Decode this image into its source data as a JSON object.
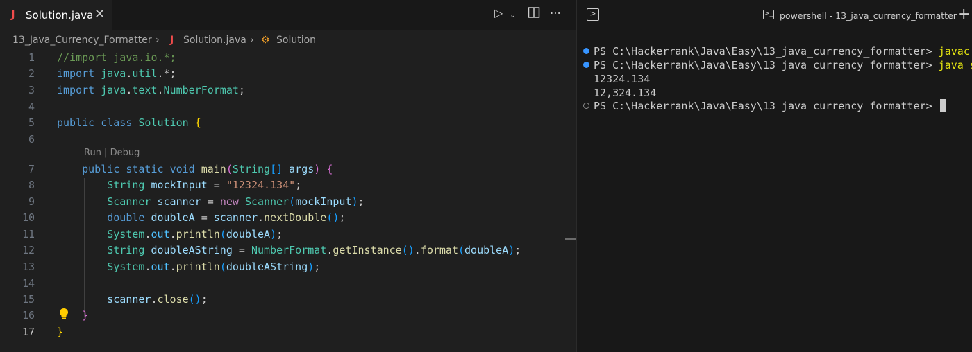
{
  "editor": {
    "tab": {
      "icon": "J",
      "filename": "Solution.java"
    },
    "breadcrumb": {
      "folder": "13_Java_Currency_Formatter",
      "file": "Solution.java",
      "symbol": "Solution"
    },
    "codelens": "Run | Debug",
    "current_line": "17",
    "lines": [
      {
        "num": "1",
        "tokens": [
          {
            "t": "//import java.io.*;",
            "c": "#6a9955"
          }
        ]
      },
      {
        "num": "2",
        "tokens": [
          {
            "t": "import ",
            "c": "#569cd6"
          },
          {
            "t": "java",
            "c": "#4ec9b0"
          },
          {
            "t": ".",
            "c": "#cccccc"
          },
          {
            "t": "util",
            "c": "#4ec9b0"
          },
          {
            "t": ".*;",
            "c": "#cccccc"
          }
        ]
      },
      {
        "num": "3",
        "tokens": [
          {
            "t": "import ",
            "c": "#569cd6"
          },
          {
            "t": "java",
            "c": "#4ec9b0"
          },
          {
            "t": ".",
            "c": "#cccccc"
          },
          {
            "t": "text",
            "c": "#4ec9b0"
          },
          {
            "t": ".",
            "c": "#cccccc"
          },
          {
            "t": "NumberFormat",
            "c": "#4ec9b0"
          },
          {
            "t": ";",
            "c": "#cccccc"
          }
        ]
      },
      {
        "num": "4",
        "tokens": []
      },
      {
        "num": "5",
        "tokens": [
          {
            "t": "public ",
            "c": "#569cd6"
          },
          {
            "t": "class ",
            "c": "#569cd6"
          },
          {
            "t": "Solution ",
            "c": "#4ec9b0"
          },
          {
            "t": "{",
            "c": "#ffd700"
          }
        ]
      },
      {
        "num": "6",
        "tokens": []
      },
      {
        "num": "7",
        "tokens": [
          {
            "t": "    public ",
            "c": "#569cd6"
          },
          {
            "t": "static ",
            "c": "#569cd6"
          },
          {
            "t": "void ",
            "c": "#569cd6"
          },
          {
            "t": "main",
            "c": "#dcdcaa"
          },
          {
            "t": "(",
            "c": "#da70d6"
          },
          {
            "t": "String",
            "c": "#4ec9b0"
          },
          {
            "t": "[] ",
            "c": "#179fff"
          },
          {
            "t": "args",
            "c": "#9cdcfe"
          },
          {
            "t": ") ",
            "c": "#da70d6"
          },
          {
            "t": "{",
            "c": "#da70d6"
          }
        ]
      },
      {
        "num": "8",
        "tokens": [
          {
            "t": "        String ",
            "c": "#4ec9b0"
          },
          {
            "t": "mockInput",
            "c": "#9cdcfe"
          },
          {
            "t": " = ",
            "c": "#cccccc"
          },
          {
            "t": "\"12324.134\"",
            "c": "#ce9178"
          },
          {
            "t": ";",
            "c": "#cccccc"
          }
        ]
      },
      {
        "num": "9",
        "tokens": [
          {
            "t": "        Scanner ",
            "c": "#4ec9b0"
          },
          {
            "t": "scanner",
            "c": "#9cdcfe"
          },
          {
            "t": " = ",
            "c": "#cccccc"
          },
          {
            "t": "new ",
            "c": "#c586c0"
          },
          {
            "t": "Scanner",
            "c": "#4ec9b0"
          },
          {
            "t": "(",
            "c": "#179fff"
          },
          {
            "t": "mockInput",
            "c": "#9cdcfe"
          },
          {
            "t": ")",
            "c": "#179fff"
          },
          {
            "t": ";",
            "c": "#cccccc"
          }
        ]
      },
      {
        "num": "10",
        "tokens": [
          {
            "t": "        double ",
            "c": "#569cd6"
          },
          {
            "t": "doubleA",
            "c": "#9cdcfe"
          },
          {
            "t": " = ",
            "c": "#cccccc"
          },
          {
            "t": "scanner",
            "c": "#9cdcfe"
          },
          {
            "t": ".",
            "c": "#cccccc"
          },
          {
            "t": "nextDouble",
            "c": "#dcdcaa"
          },
          {
            "t": "()",
            "c": "#179fff"
          },
          {
            "t": ";",
            "c": "#cccccc"
          }
        ]
      },
      {
        "num": "11",
        "tokens": [
          {
            "t": "        System",
            "c": "#4ec9b0"
          },
          {
            "t": ".",
            "c": "#cccccc"
          },
          {
            "t": "out",
            "c": "#4fc1ff"
          },
          {
            "t": ".",
            "c": "#cccccc"
          },
          {
            "t": "println",
            "c": "#dcdcaa"
          },
          {
            "t": "(",
            "c": "#179fff"
          },
          {
            "t": "doubleA",
            "c": "#9cdcfe"
          },
          {
            "t": ")",
            "c": "#179fff"
          },
          {
            "t": ";",
            "c": "#cccccc"
          }
        ]
      },
      {
        "num": "12",
        "tokens": [
          {
            "t": "        String ",
            "c": "#4ec9b0"
          },
          {
            "t": "doubleAString",
            "c": "#9cdcfe"
          },
          {
            "t": " = ",
            "c": "#cccccc"
          },
          {
            "t": "NumberFormat",
            "c": "#4ec9b0"
          },
          {
            "t": ".",
            "c": "#cccccc"
          },
          {
            "t": "getInstance",
            "c": "#dcdcaa"
          },
          {
            "t": "()",
            "c": "#179fff"
          },
          {
            "t": ".",
            "c": "#cccccc"
          },
          {
            "t": "format",
            "c": "#dcdcaa"
          },
          {
            "t": "(",
            "c": "#179fff"
          },
          {
            "t": "doubleA",
            "c": "#9cdcfe"
          },
          {
            "t": ")",
            "c": "#179fff"
          },
          {
            "t": ";",
            "c": "#cccccc"
          }
        ]
      },
      {
        "num": "13",
        "tokens": [
          {
            "t": "        System",
            "c": "#4ec9b0"
          },
          {
            "t": ".",
            "c": "#cccccc"
          },
          {
            "t": "out",
            "c": "#4fc1ff"
          },
          {
            "t": ".",
            "c": "#cccccc"
          },
          {
            "t": "println",
            "c": "#dcdcaa"
          },
          {
            "t": "(",
            "c": "#179fff"
          },
          {
            "t": "doubleAString",
            "c": "#9cdcfe"
          },
          {
            "t": ")",
            "c": "#179fff"
          },
          {
            "t": ";",
            "c": "#cccccc"
          }
        ]
      },
      {
        "num": "14",
        "tokens": []
      },
      {
        "num": "15",
        "tokens": [
          {
            "t": "        scanner",
            "c": "#9cdcfe"
          },
          {
            "t": ".",
            "c": "#cccccc"
          },
          {
            "t": "close",
            "c": "#dcdcaa"
          },
          {
            "t": "()",
            "c": "#179fff"
          },
          {
            "t": ";",
            "c": "#cccccc"
          }
        ]
      },
      {
        "num": "16",
        "tokens": [
          {
            "t": "    }",
            "c": "#da70d6"
          }
        ]
      },
      {
        "num": "17",
        "tokens": [
          {
            "t": "}",
            "c": "#ffd700"
          }
        ]
      }
    ]
  },
  "terminal": {
    "title": "powershell - 13_java_currency_formatter",
    "lines": [
      {
        "marker": "filled",
        "text": "PS C:\\Hackerrank\\Java\\Easy\\13_java_currency_formatter> ",
        "cmd": "javac",
        "cmd_color": "#e5e510"
      },
      {
        "marker": "filled",
        "text": "PS C:\\Hackerrank\\Java\\Easy\\13_java_currency_formatter> ",
        "cmd": "java s",
        "cmd_color": "#e5e510"
      },
      {
        "marker": "none",
        "text": "12324.134",
        "cmd": "",
        "cmd_color": ""
      },
      {
        "marker": "none",
        "text": "12,324.134",
        "cmd": "",
        "cmd_color": ""
      },
      {
        "marker": "empty",
        "text": "PS C:\\Hackerrank\\Java\\Easy\\13_java_currency_formatter> ",
        "cmd": "",
        "cmd_color": "",
        "cursor": true
      }
    ]
  }
}
